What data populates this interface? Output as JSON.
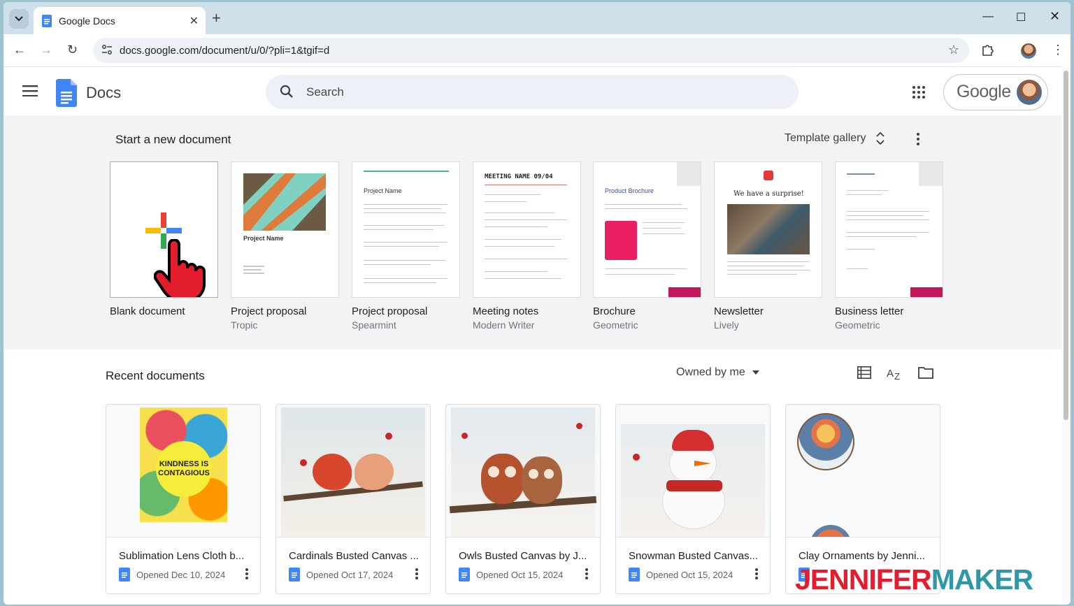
{
  "browser": {
    "tab_title": "Google Docs",
    "url": "docs.google.com/document/u/0/?pli=1&tgif=d"
  },
  "header": {
    "app_name": "Docs",
    "search_placeholder": "Search",
    "account_label": "Google"
  },
  "templates": {
    "section_title": "Start a new document",
    "gallery_label": "Template gallery",
    "items": [
      {
        "name": "Blank document",
        "theme": ""
      },
      {
        "name": "Project proposal",
        "theme": "Tropic"
      },
      {
        "name": "Project proposal",
        "theme": "Spearmint"
      },
      {
        "name": "Meeting notes",
        "theme": "Modern Writer"
      },
      {
        "name": "Brochure",
        "theme": "Geometric"
      },
      {
        "name": "Newsletter",
        "theme": "Lively"
      },
      {
        "name": "Business letter",
        "theme": "Geometric"
      }
    ],
    "thumb_text": {
      "tropic_title": "Project Name",
      "spearmint_title": "Project Name",
      "meeting_title": "MEETING NAME 09/04",
      "brochure_title": "Product Brochure",
      "newsletter_title": "We have a surprise!"
    }
  },
  "recent": {
    "section_title": "Recent documents",
    "owner_filter": "Owned by me",
    "docs": [
      {
        "title": "Sublimation Lens Cloth b...",
        "opened": "Opened Dec 10, 2024",
        "thumb_text": "KINDNESS IS CONTAGIOUS"
      },
      {
        "title": "Cardinals Busted Canvas ...",
        "opened": "Opened Oct 17, 2024"
      },
      {
        "title": "Owls Busted Canvas by J...",
        "opened": "Opened Oct 15, 2024"
      },
      {
        "title": "Snowman Busted Canvas...",
        "opened": "Opened Oct 15, 2024"
      },
      {
        "title": "Clay Ornaments by Jenni...",
        "opened": ""
      }
    ]
  },
  "watermark": {
    "part1": "JENNIFER",
    "part2": "MAKER"
  },
  "colors": {
    "docs_blue": "#4285f4",
    "brand_red": "#e41d2e",
    "brand_teal": "#2e98a8"
  }
}
